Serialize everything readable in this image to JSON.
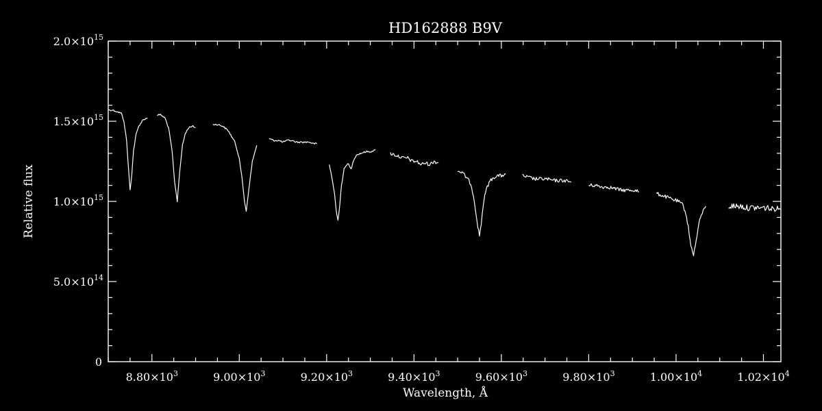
{
  "chart_data": {
    "type": "line",
    "title": "HD162888   B9V",
    "xlabel": "Wavelength, Å",
    "ylabel": "Relative flux",
    "xlim": [
      8700,
      10240
    ],
    "ylim": [
      0,
      2000000000000000.0
    ],
    "x_ticks": [
      {
        "value": 8800,
        "mant": "8.80",
        "exp": "3"
      },
      {
        "value": 9000,
        "mant": "9.00",
        "exp": "3"
      },
      {
        "value": 9200,
        "mant": "9.20",
        "exp": "3"
      },
      {
        "value": 9400,
        "mant": "9.40",
        "exp": "3"
      },
      {
        "value": 9600,
        "mant": "9.60",
        "exp": "3"
      },
      {
        "value": 9800,
        "mant": "9.80",
        "exp": "3"
      },
      {
        "value": 10000,
        "mant": "1.00",
        "exp": "4"
      },
      {
        "value": 10200,
        "mant": "1.02",
        "exp": "4"
      }
    ],
    "y_ticks": [
      {
        "value": 0,
        "mant": "0",
        "exp": ""
      },
      {
        "value": 500000000000000.0,
        "mant": "5.0",
        "exp": "14"
      },
      {
        "value": 1000000000000000.0,
        "mant": "1.0",
        "exp": "15"
      },
      {
        "value": 1500000000000000.0,
        "mant": "1.5",
        "exp": "15"
      },
      {
        "value": 2000000000000000.0,
        "mant": "2.0",
        "exp": "15"
      }
    ],
    "color": "#ffffff",
    "segments": [
      {
        "x": [
          8700,
          8710,
          8720,
          8730,
          8736,
          8742,
          8746,
          8750,
          8754,
          8758,
          8764,
          8770,
          8780,
          8790
        ],
        "y": [
          1570000000000000.0,
          1570000000000000.0,
          1560000000000000.0,
          1550000000000000.0,
          1500000000000000.0,
          1380000000000000.0,
          1220000000000000.0,
          1070000000000000.0,
          1170000000000000.0,
          1320000000000000.0,
          1420000000000000.0,
          1470000000000000.0,
          1510000000000000.0,
          1520000000000000.0
        ]
      },
      {
        "x": [
          8812,
          8820,
          8830,
          8838,
          8846,
          8852,
          8858,
          8864,
          8870,
          8876,
          8884,
          8892,
          8900
        ],
        "y": [
          1540000000000000.0,
          1540000000000000.0,
          1520000000000000.0,
          1460000000000000.0,
          1320000000000000.0,
          1120000000000000.0,
          1000000000000000.0,
          1200000000000000.0,
          1350000000000000.0,
          1420000000000000.0,
          1460000000000000.0,
          1470000000000000.0,
          1460000000000000.0
        ]
      },
      {
        "x": [
          8940,
          8950,
          8962,
          8975,
          8990,
          9000,
          9006,
          9012,
          9016,
          9022,
          9030,
          9040
        ],
        "y": [
          1480000000000000.0,
          1480000000000000.0,
          1470000000000000.0,
          1440000000000000.0,
          1370000000000000.0,
          1270000000000000.0,
          1150000000000000.0,
          1000000000000000.0,
          940000000000000.0,
          1080000000000000.0,
          1250000000000000.0,
          1350000000000000.0
        ]
      },
      {
        "x": [
          9068,
          9080,
          9090,
          9100,
          9110,
          9120,
          9130,
          9140,
          9150,
          9160,
          9170,
          9178
        ],
        "y": [
          1390000000000000.0,
          1380000000000000.0,
          1380000000000000.0,
          1370000000000000.0,
          1380000000000000.0,
          1380000000000000.0,
          1370000000000000.0,
          1370000000000000.0,
          1370000000000000.0,
          1370000000000000.0,
          1360000000000000.0,
          1360000000000000.0
        ]
      },
      {
        "x": [
          9206,
          9212,
          9218,
          9222,
          9226,
          9230,
          9234,
          9240,
          9248,
          9256,
          9262,
          9268,
          9278,
          9290,
          9300,
          9312
        ],
        "y": [
          1230000000000000.0,
          1150000000000000.0,
          1050000000000000.0,
          940000000000000.0,
          880000000000000.0,
          980000000000000.0,
          1100000000000000.0,
          1200000000000000.0,
          1240000000000000.0,
          1200000000000000.0,
          1260000000000000.0,
          1290000000000000.0,
          1300000000000000.0,
          1310000000000000.0,
          1310000000000000.0,
          1320000000000000.0
        ]
      },
      {
        "x": [
          9346,
          9356,
          9366,
          9376,
          9386,
          9396,
          9406,
          9416,
          9426,
          9436,
          9446,
          9456
        ],
        "y": [
          1300000000000000.0,
          1290000000000000.0,
          1280000000000000.0,
          1270000000000000.0,
          1270000000000000.0,
          1250000000000000.0,
          1250000000000000.0,
          1230000000000000.0,
          1240000000000000.0,
          1230000000000000.0,
          1250000000000000.0,
          1240000000000000.0
        ]
      },
      {
        "x": [
          9500,
          9510,
          9520,
          9530,
          9536,
          9542,
          9546,
          9550,
          9554,
          9558,
          9564,
          9572,
          9582,
          9592,
          9600,
          9610
        ],
        "y": [
          1190000000000000.0,
          1180000000000000.0,
          1150000000000000.0,
          1110000000000000.0,
          1040000000000000.0,
          930000000000000.0,
          840000000000000.0,
          790000000000000.0,
          860000000000000.0,
          970000000000000.0,
          1060000000000000.0,
          1120000000000000.0,
          1150000000000000.0,
          1160000000000000.0,
          1160000000000000.0,
          1170000000000000.0
        ]
      },
      {
        "x": [
          9648,
          9662,
          9676,
          9690,
          9704,
          9718,
          9732,
          9746,
          9760
        ],
        "y": [
          1160000000000000.0,
          1150000000000000.0,
          1140000000000000.0,
          1140000000000000.0,
          1140000000000000.0,
          1130000000000000.0,
          1130000000000000.0,
          1130000000000000.0,
          1120000000000000.0
        ]
      },
      {
        "x": [
          9800,
          9815,
          9830,
          9845,
          9860,
          9875,
          9890,
          9905,
          9915
        ],
        "y": [
          1100000000000000.0,
          1100000000000000.0,
          1090000000000000.0,
          1090000000000000.0,
          1080000000000000.0,
          1070000000000000.0,
          1070000000000000.0,
          1070000000000000.0,
          1060000000000000.0
        ]
      },
      {
        "x": [
          9955,
          9965,
          9975,
          9985,
          9995,
          10005,
          10015,
          10022,
          10028,
          10034,
          10040,
          10046,
          10052,
          10060,
          10068
        ],
        "y": [
          1050000000000000.0,
          1040000000000000.0,
          1030000000000000.0,
          1020000000000000.0,
          1010000000000000.0,
          1000000000000000.0,
          980000000000000.0,
          930000000000000.0,
          840000000000000.0,
          720000000000000.0,
          670000000000000.0,
          750000000000000.0,
          860000000000000.0,
          930000000000000.0,
          970000000000000.0
        ]
      },
      {
        "x": [
          10120,
          10130,
          10140,
          10150,
          10160,
          10170,
          10180,
          10190,
          10200,
          10210,
          10220,
          10230,
          10240
        ],
        "y": [
          970000000000000.0,
          970000000000000.0,
          970000000000000.0,
          970000000000000.0,
          960000000000000.0,
          960000000000000.0,
          960000000000000.0,
          960000000000000.0,
          960000000000000.0,
          960000000000000.0,
          950000000000000.0,
          960000000000000.0,
          950000000000000.0
        ]
      }
    ]
  }
}
